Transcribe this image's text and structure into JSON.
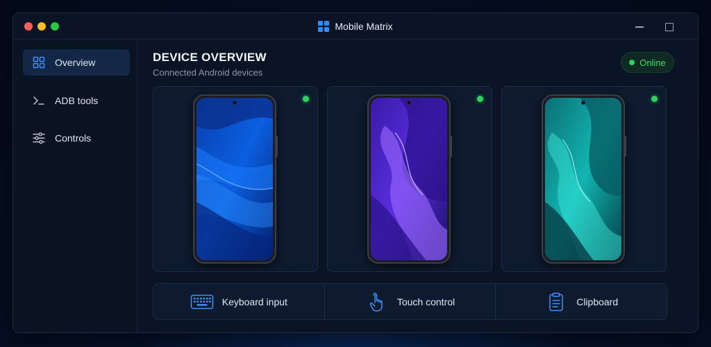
{
  "window": {
    "title": "Mobile Matrix"
  },
  "sidebar": {
    "items": [
      {
        "label": "Overview",
        "icon": "grid-icon",
        "active": true
      },
      {
        "label": "ADB tools",
        "icon": "terminal-icon",
        "active": false
      },
      {
        "label": "Controls",
        "icon": "sliders-icon",
        "active": false
      }
    ]
  },
  "main": {
    "title": "DEVICE OVERVIEW",
    "subtitle": "Connected Android devices",
    "status": {
      "label": "Online",
      "color": "#2fd35c"
    },
    "devices": [
      {
        "wallpaper": "blue",
        "online": true
      },
      {
        "wallpaper": "purple",
        "online": true
      },
      {
        "wallpaper": "teal",
        "online": true
      }
    ],
    "actions": [
      {
        "label": "Keyboard input",
        "icon": "keyboard-icon"
      },
      {
        "label": "Touch control",
        "icon": "touch-icon"
      },
      {
        "label": "Clipboard",
        "icon": "clipboard-icon"
      }
    ]
  },
  "colors": {
    "accent": "#2f8cff",
    "online": "#2fd35c"
  }
}
